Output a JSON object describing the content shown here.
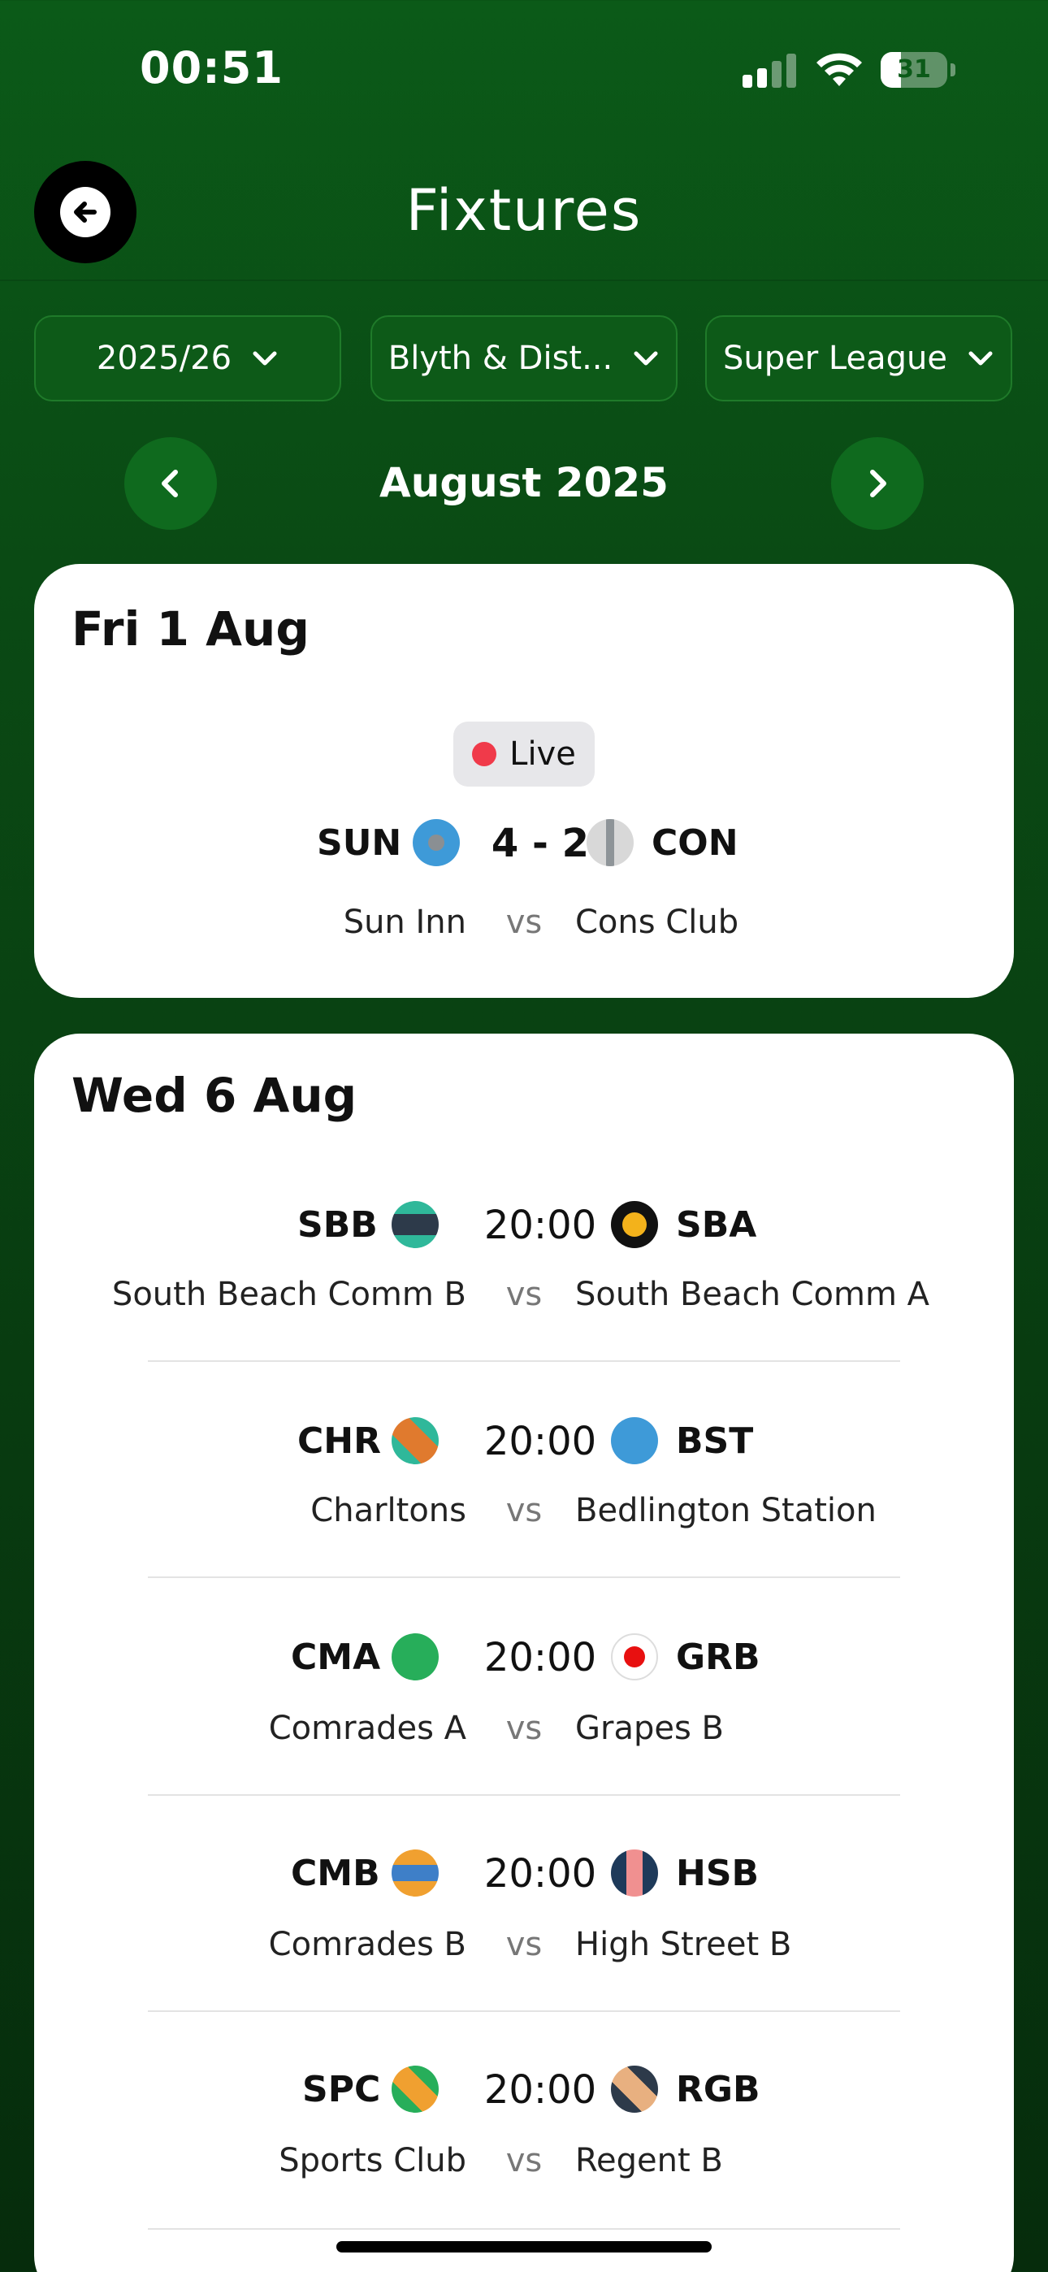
{
  "status_bar": {
    "time": "00:51",
    "battery": "31",
    "battery_level": 0.31
  },
  "header": {
    "title": "Fixtures"
  },
  "filters": [
    {
      "label": "2025/26"
    },
    {
      "label": "Blyth & Dist..."
    },
    {
      "label": "Super League"
    }
  ],
  "month": {
    "label": "August 2025"
  },
  "colors": {
    "bg_green": "#0b5a18",
    "live_red": "#f03a4a",
    "card_bg": "#ffffff"
  },
  "days": [
    {
      "date": "Fri 1 Aug",
      "live_label": "Live",
      "fixtures": [
        {
          "home_code": "SUN",
          "away_code": "CON",
          "score": "4 - 2",
          "home_name": "Sun Inn",
          "vs": "vs",
          "away_name": "Cons Club",
          "home_badge": "blue-grey-dot",
          "away_badge": "grey-stripe"
        }
      ]
    },
    {
      "date": "Wed 6 Aug",
      "fixtures": [
        {
          "home_code": "SBB",
          "away_code": "SBA",
          "time": "20:00",
          "home_name": "South Beach Comm B",
          "vs": "vs",
          "away_name": "South Beach Comm A"
        },
        {
          "home_code": "CHR",
          "away_code": "BST",
          "time": "20:00",
          "home_name": "Charltons",
          "vs": "vs",
          "away_name": "Bedlington Station"
        },
        {
          "home_code": "CMA",
          "away_code": "GRB",
          "time": "20:00",
          "home_name": "Comrades A",
          "vs": "vs",
          "away_name": "Grapes B"
        },
        {
          "home_code": "CMB",
          "away_code": "HSB",
          "time": "20:00",
          "home_name": "Comrades B",
          "vs": "vs",
          "away_name": "High Street B"
        },
        {
          "home_code": "SPC",
          "away_code": "RGB",
          "time": "20:00",
          "home_name": "Sports Club",
          "vs": "vs",
          "away_name": "Regent B"
        }
      ]
    }
  ]
}
